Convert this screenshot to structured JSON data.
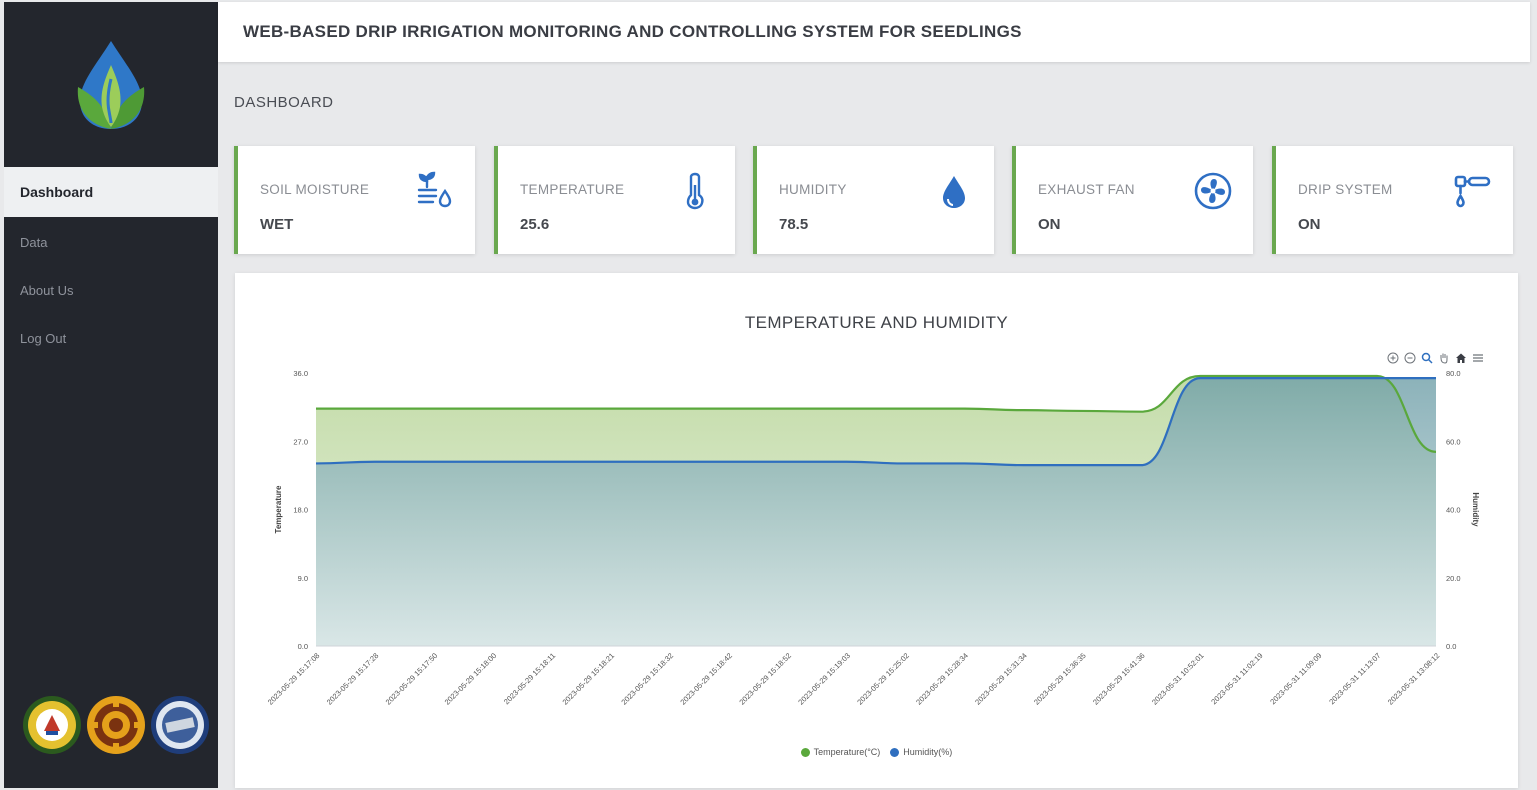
{
  "app": {
    "title": "WEB-BASED DRIP IRRIGATION MONITORING AND CONTROLLING SYSTEM FOR SEEDLINGS",
    "logo_icon": "leaf-water-drop-logo"
  },
  "sidebar": {
    "items": [
      {
        "label": "Dashboard",
        "active": true
      },
      {
        "label": "Data",
        "active": false
      },
      {
        "label": "About Us",
        "active": false
      },
      {
        "label": "Log Out",
        "active": false
      }
    ],
    "seals": [
      "university-seal",
      "gear-seal",
      "department-seal"
    ]
  },
  "page": {
    "section_title": "DASHBOARD"
  },
  "cards": [
    {
      "label": "SOIL MOISTURE",
      "value": "WET",
      "icon": "plant-water-icon"
    },
    {
      "label": "TEMPERATURE",
      "value": "25.6",
      "icon": "thermometer-icon"
    },
    {
      "label": "HUMIDITY",
      "value": "78.5",
      "icon": "water-drop-icon"
    },
    {
      "label": "EXHAUST FAN",
      "value": "ON",
      "icon": "fan-icon"
    },
    {
      "label": "DRIP SYSTEM",
      "value": "ON",
      "icon": "drip-pipe-icon"
    }
  ],
  "colors": {
    "accent_green": "#6aa84f",
    "icon_blue": "#2f6fc4",
    "temperature_line": "#6aa84f",
    "humidity_line": "#2f6fbf",
    "sidebar_bg": "#23262d"
  },
  "chart_data": {
    "type": "area",
    "title": "TEMPERATURE AND HUMIDITY",
    "x": [
      "2023-05-29 15:17:08",
      "2023-05-29 15:17:28",
      "2023-05-29 15:17:50",
      "2023-05-29 15:18:00",
      "2023-05-29 15:18:11",
      "2023-05-29 15:18:21",
      "2023-05-29 15:18:32",
      "2023-05-29 15:18:42",
      "2023-05-29 15:18:52",
      "2023-05-29 15:19:03",
      "2023-05-29 15:25:02",
      "2023-05-29 15:28:34",
      "2023-05-29 15:31:34",
      "2023-05-29 15:36:35",
      "2023-05-29 15:41:36",
      "2023-05-31 10:52:01",
      "2023-05-31 11:02:19",
      "2023-05-31 11:09:09",
      "2023-05-31 11:13:07",
      "2023-05-31 13:08:12"
    ],
    "series": [
      {
        "name": "Temperature(°C)",
        "axis": "left",
        "values": [
          31.3,
          31.3,
          31.3,
          31.3,
          31.3,
          31.3,
          31.3,
          31.3,
          31.3,
          31.3,
          31.3,
          31.3,
          31.1,
          31.0,
          30.9,
          35.6,
          35.6,
          35.6,
          35.6,
          25.6
        ]
      },
      {
        "name": "Humidity(%)",
        "axis": "right",
        "values": [
          53.5,
          54.0,
          54.0,
          54.0,
          54.0,
          54.0,
          54.0,
          54.0,
          54.0,
          54.0,
          53.5,
          53.5,
          53.0,
          53.0,
          53.0,
          78.5,
          78.5,
          78.5,
          78.5,
          78.5
        ]
      }
    ],
    "ylabel": "Temperature",
    "y2label": "Humidity",
    "ylim": [
      0,
      36
    ],
    "y2lim": [
      0,
      80
    ],
    "yticks": [
      "0.0",
      "9.0",
      "18.0",
      "27.0",
      "36.0"
    ],
    "y2ticks": [
      "0.0",
      "20.0",
      "40.0",
      "60.0",
      "80.0"
    ],
    "legend": "bottom-center",
    "grid": false
  },
  "chart_tools": [
    "zoom-in-icon",
    "zoom-out-icon",
    "search-icon",
    "pan-icon",
    "home-icon",
    "menu-icon"
  ]
}
